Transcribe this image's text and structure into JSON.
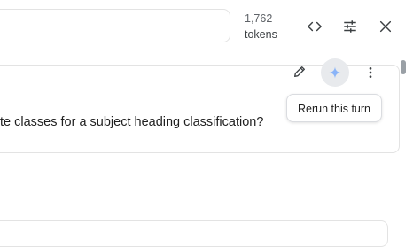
{
  "header": {
    "token_count": "1,762",
    "token_unit": "tokens",
    "icons": [
      "code-icon",
      "tune-icon",
      "close-icon"
    ]
  },
  "chat": {
    "message_text": "te classes for a subject heading classification?",
    "actions": {
      "edit_icon": "pencil-icon",
      "rerun_icon": "sparkle-icon",
      "more_icon": "more-vert-icon",
      "tooltip": "Rerun this turn"
    }
  },
  "colors": {
    "sparkle": "#8ab4f8",
    "sparkle_bg": "#e8eaed",
    "border": "#e3e3e3",
    "scrollbar": "#9aa0a6"
  }
}
